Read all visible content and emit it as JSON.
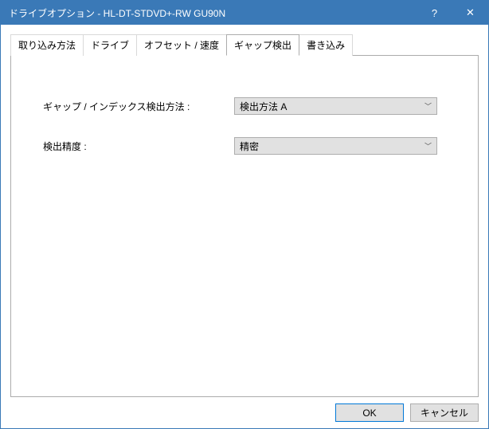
{
  "titlebar": {
    "title": "ドライブオプション - HL-DT-STDVD+-RW GU90N",
    "help": "?",
    "close": "✕"
  },
  "tabs": [
    {
      "label": "取り込み方法"
    },
    {
      "label": "ドライブ"
    },
    {
      "label": "オフセット / 速度"
    },
    {
      "label": "ギャップ検出"
    },
    {
      "label": "書き込み"
    }
  ],
  "active_tab": 3,
  "form": {
    "method": {
      "label": "ギャップ / インデックス検出方法 :",
      "value": "検出方法 A"
    },
    "accuracy": {
      "label": "検出精度 :",
      "value": "精密"
    }
  },
  "buttons": {
    "ok": "OK",
    "cancel": "キャンセル"
  }
}
